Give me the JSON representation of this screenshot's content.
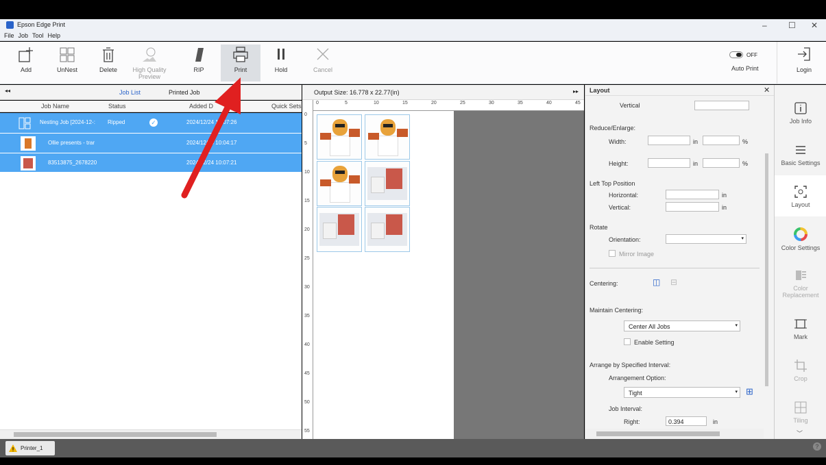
{
  "window": {
    "title": "Epson Edge Print",
    "min": "–",
    "max": "☐",
    "close": "✕"
  },
  "menu": [
    "File",
    "Job",
    "Tool",
    "Help"
  ],
  "toolbar": {
    "add": "Add",
    "unnest": "UnNest",
    "delete": "Delete",
    "hq_preview": "High Quality Preview",
    "rip": "RIP",
    "print": "Print",
    "hold": "Hold",
    "cancel": "Cancel",
    "auto_print": "Auto Print",
    "toggle": "OFF",
    "login": "Login"
  },
  "joblist": {
    "tab_job_list": "Job List",
    "tab_printed": "Printed Job",
    "collapse": "◂◂",
    "cols": [
      "Job Name",
      "Status",
      "Added D",
      "Quick Sets"
    ],
    "rows": [
      {
        "name": "Nesting Job [2024-12-:",
        "status": "Ripped",
        "added": "2024/12/24 10:07:26"
      },
      {
        "name": "Ollie presents - trar",
        "status": "",
        "added": "2024/12/24 10:04:17"
      },
      {
        "name": "83513875_2678220",
        "status": "",
        "added": "2024/12/24 10:07:21"
      }
    ]
  },
  "preview": {
    "output_size": "Output Size: 16.778 x 22.77(in)",
    "top_ticks": [
      "0",
      "5",
      "10",
      "15",
      "20",
      "25",
      "30",
      "35",
      "40",
      "45"
    ],
    "left_ticks": [
      "0",
      "5",
      "10",
      "15",
      "20",
      "25",
      "30",
      "35",
      "40",
      "45",
      "50",
      "55"
    ]
  },
  "layout": {
    "title": "Layout",
    "vertical": "Vertical",
    "reduce": "Reduce/Enlarge:",
    "width": "Width:",
    "height": "Height:",
    "unit_in": "in",
    "unit_pct": "%",
    "ltpos": "Left Top Position",
    "horizontal": "Horizontal:",
    "vertical2": "Vertical:",
    "rotate": "Rotate",
    "orientation": "Orientation:",
    "mirror": "Mirror Image",
    "centering": "Centering:",
    "maintain": "Maintain Centering:",
    "center_all": "Center All Jobs",
    "enable": "Enable Setting",
    "arrange": "Arrange by Specified Interval:",
    "arr_option": "Arrangement Option:",
    "tight": "Tight",
    "job_interval": "Job Interval:",
    "right": "Right:",
    "right_val": "0.394"
  },
  "nav": [
    {
      "label": "Job Info"
    },
    {
      "label": "Basic Settings"
    },
    {
      "label": "Layout"
    },
    {
      "label": "Color Settings"
    },
    {
      "label": "Color Replacement"
    },
    {
      "label": "Mark"
    },
    {
      "label": "Crop"
    },
    {
      "label": "Tiling"
    }
  ],
  "status": {
    "printer": "Printer_1"
  },
  "colors": {
    "selection": "#4fa7f3",
    "arrow": "#e02020"
  }
}
